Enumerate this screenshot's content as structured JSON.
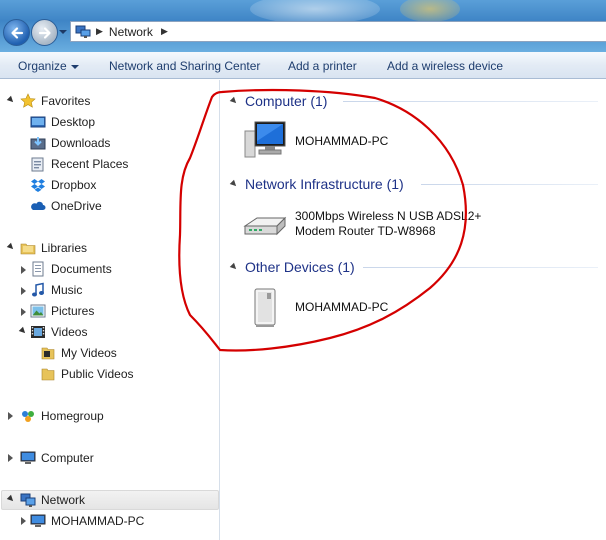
{
  "address_bar": {
    "location": "Network"
  },
  "toolbar": {
    "organize": "Organize",
    "network_sharing_center": "Network and Sharing Center",
    "add_printer": "Add a printer",
    "add_wireless_device": "Add a wireless device"
  },
  "nav": {
    "favorites": {
      "label": "Favorites",
      "items": [
        "Desktop",
        "Downloads",
        "Recent Places",
        "Dropbox",
        "OneDrive"
      ]
    },
    "libraries": {
      "label": "Libraries",
      "items": [
        "Documents",
        "Music",
        "Pictures",
        "Videos"
      ],
      "videos_children": [
        "My Videos",
        "Public Videos"
      ]
    },
    "homegroup": "Homegroup",
    "computer": "Computer",
    "network": {
      "label": "Network",
      "children": [
        "MOHAMMAD-PC"
      ]
    }
  },
  "groups": [
    {
      "title": "Computer (1)",
      "items": [
        {
          "name": "MOHAMMAD-PC",
          "icon": "computer-icon"
        }
      ]
    },
    {
      "title": "Network Infrastructure (1)",
      "items": [
        {
          "name_line1": "300Mbps Wireless N USB ADSL2+",
          "name_line2": "Modem Router TD-W8968",
          "icon": "router-icon"
        }
      ]
    },
    {
      "title": "Other Devices (1)",
      "items": [
        {
          "name": "MOHAMMAD-PC",
          "icon": "media-device-icon"
        }
      ]
    }
  ],
  "colors": {
    "group_header": "#1e3287",
    "toolbar_text": "#1e3d6e",
    "annotation": "#d40000"
  }
}
